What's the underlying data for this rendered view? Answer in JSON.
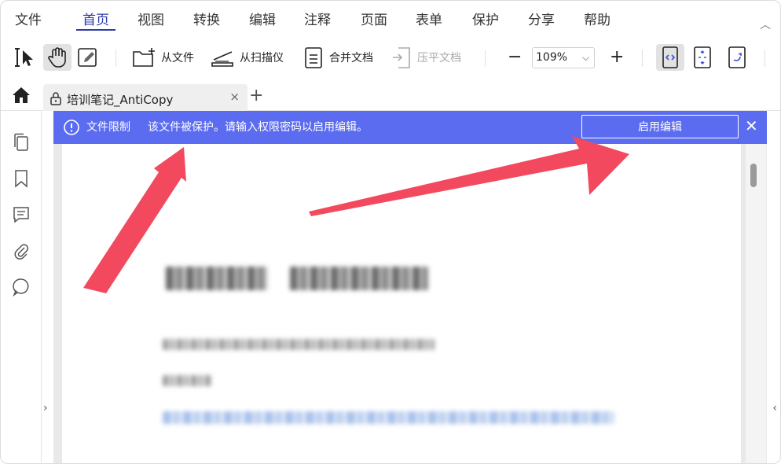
{
  "menu": {
    "items": [
      "文件",
      "首页",
      "视图",
      "转换",
      "编辑",
      "注释",
      "页面",
      "表单",
      "保护",
      "分享",
      "帮助"
    ],
    "active": "首页"
  },
  "toolbar": {
    "from_file": "从文件",
    "from_scanner": "从扫描仪",
    "merge_docs": "合并文档",
    "flatten_doc": "压平文档",
    "zoom_value": "109%",
    "zoom_out": "−",
    "zoom_in": "+"
  },
  "tabs": {
    "doc_title": "培训笔记_AntiCopy",
    "close": "×",
    "new_tab": "+"
  },
  "banner": {
    "label": "文件限制",
    "message": "该文件被保护。请输入权限密码以启用编辑。",
    "button": "启用编辑",
    "close": "✕"
  },
  "colors": {
    "accent": "#2b3aa8",
    "banner": "#5b6cf0",
    "arrow": "#f2495f"
  },
  "icons": [
    "select-cursor-icon",
    "hand-icon",
    "edit-icon",
    "add-file-icon",
    "scanner-icon",
    "merge-doc-icon",
    "flatten-doc-icon",
    "fit-width-icon",
    "fit-page-icon",
    "rotate-view-icon",
    "home-icon",
    "lock-icon",
    "pages-icon",
    "bookmark-icon",
    "comment-icon",
    "attachment-icon",
    "search-bubble-icon",
    "info-icon"
  ]
}
